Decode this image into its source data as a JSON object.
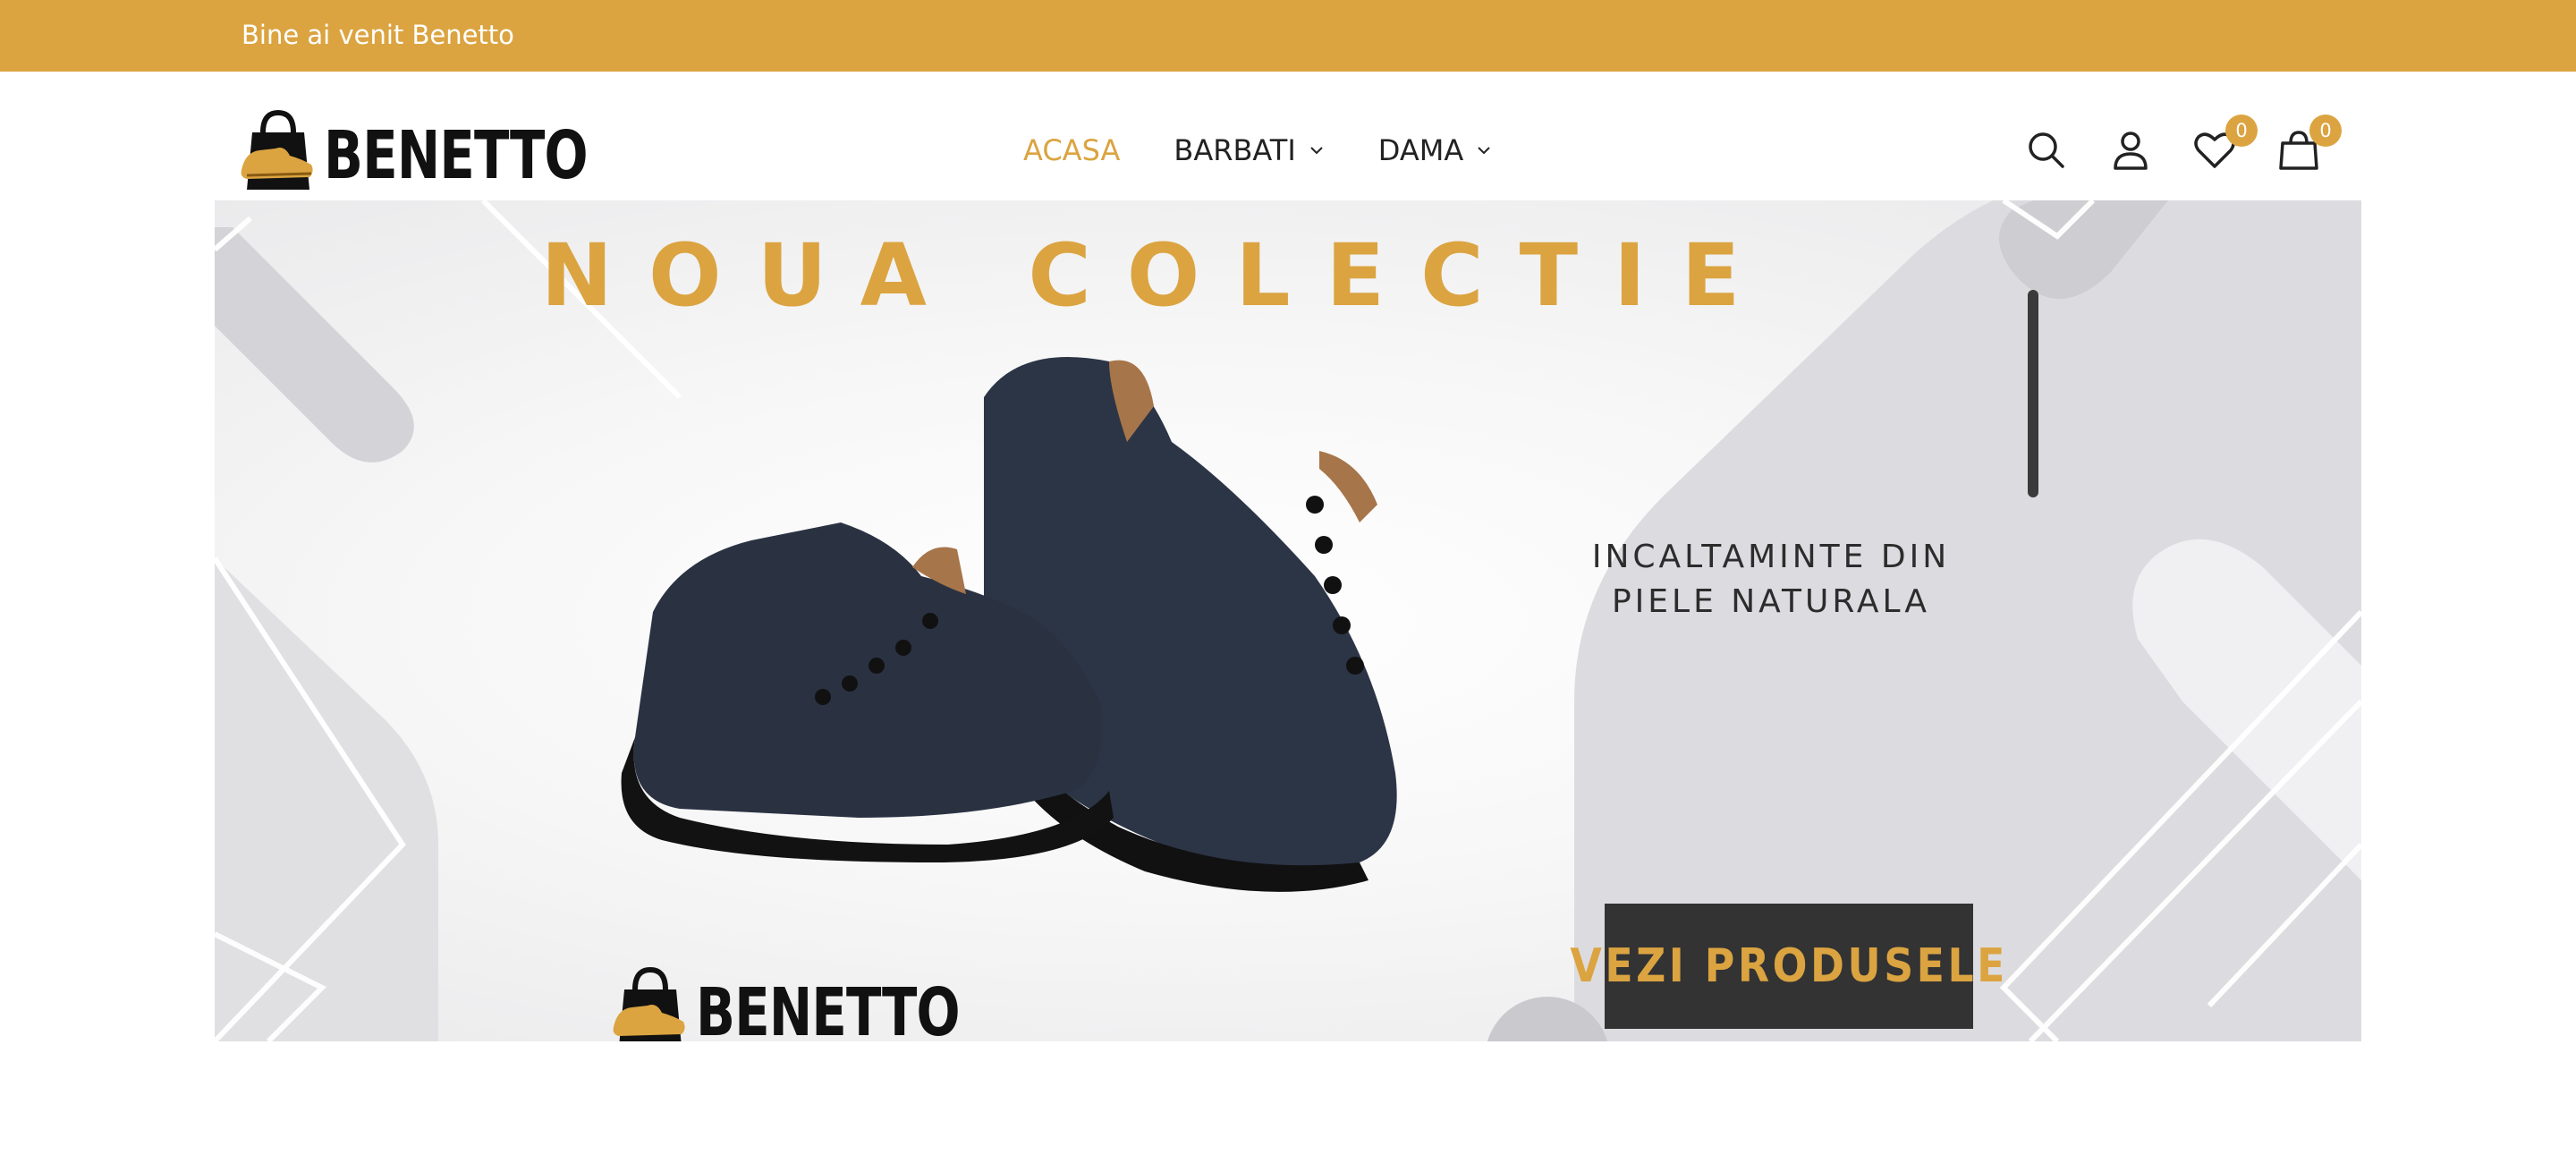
{
  "topbar": {
    "welcome": "Bine ai venit Benetto"
  },
  "brand": {
    "name": "BENETTO",
    "accent": "#dba441",
    "dark": "#333333"
  },
  "nav": {
    "items": [
      {
        "label": "ACASA",
        "active": true,
        "dropdown": false
      },
      {
        "label": "BARBATI",
        "active": false,
        "dropdown": true
      },
      {
        "label": "DAMA",
        "active": false,
        "dropdown": true
      }
    ]
  },
  "header_icons": {
    "search": "search-icon",
    "account": "user-icon",
    "wishlist": {
      "icon": "heart-icon",
      "count": "0"
    },
    "cart": {
      "icon": "shopping-bag-icon",
      "count": "0"
    }
  },
  "hero": {
    "title": "NOUA COLECTIE",
    "subtitle_line1": "INCALTAMINTE DIN",
    "subtitle_line2": "PIELE NATURALA",
    "button": "VEZI PRODUSELE",
    "image": "navy-leather-sneakers"
  }
}
